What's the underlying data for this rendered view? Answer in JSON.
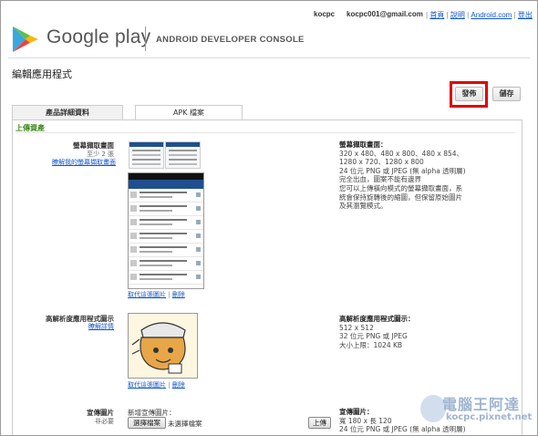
{
  "header": {
    "user": "kocpc",
    "email": "kocpc001@gmail.com",
    "links": [
      "首頁",
      "說明",
      "Android.com",
      "登出"
    ],
    "separator": "|",
    "brand": "Google play",
    "console_title": "ANDROID DEVELOPER CONSOLE"
  },
  "page": {
    "title": "編輯應用程式",
    "publish_label": "發佈",
    "save_label": "儲存"
  },
  "tabs": [
    {
      "label": "產品詳細資料",
      "active": true
    },
    {
      "label": "APK 檔案",
      "active": false
    }
  ],
  "upload_section": {
    "title": "上傳資產",
    "screenshots": {
      "label": "螢幕擷取畫面",
      "sublabel": "至少 2 張",
      "link": "瞭解我的螢幕擷取畫面",
      "actions": {
        "replace": "取代這張圖片",
        "delete": "刪除",
        "sep": "|"
      },
      "info_title": "螢幕擷取畫面：",
      "info_lines": [
        "320 x 480、480 x 800、480 x 854、",
        "1280 x 720、1280 x 800",
        "24 位元 PNG 或 JPEG (無 alpha 透明層)",
        "完全出血，圖案不能有邊界",
        "您可以上傳橫向模式的螢幕擷取畫面，系",
        "統會保持旋轉後的縮圖，但保留原始圖片",
        "及其瀏覽模式。"
      ]
    },
    "hi_res_icon": {
      "label": "高解析度應用程式圖示",
      "link": "瞭解詳情",
      "actions": {
        "replace": "取代這張圖片",
        "delete": "刪除",
        "sep": "|"
      },
      "info_title": "高解析度應用程式圖示：",
      "info_lines": [
        "512 x 512",
        "32 位元 PNG 或 JPEG",
        "大小上限：1024 KB"
      ]
    },
    "promo": {
      "label": "宣傳圖片",
      "sublabel": "非必要",
      "add_label": "新增宣傳圖片：",
      "choose_file": "選擇檔案",
      "no_file": "未選擇檔案",
      "upload": "上傳",
      "info_title": "宣傳圖片：",
      "info_lines": [
        "寬 180 x 長 120",
        "24 位元 PNG 或 JPEG (無 alpha 透明層)"
      ]
    }
  },
  "watermark": {
    "title": "電腦王阿達",
    "url": "kocpc.pixnet.net"
  },
  "colors": {
    "highlight": "#e00000",
    "section_title": "#3a8a19",
    "link": "#1155cc"
  }
}
